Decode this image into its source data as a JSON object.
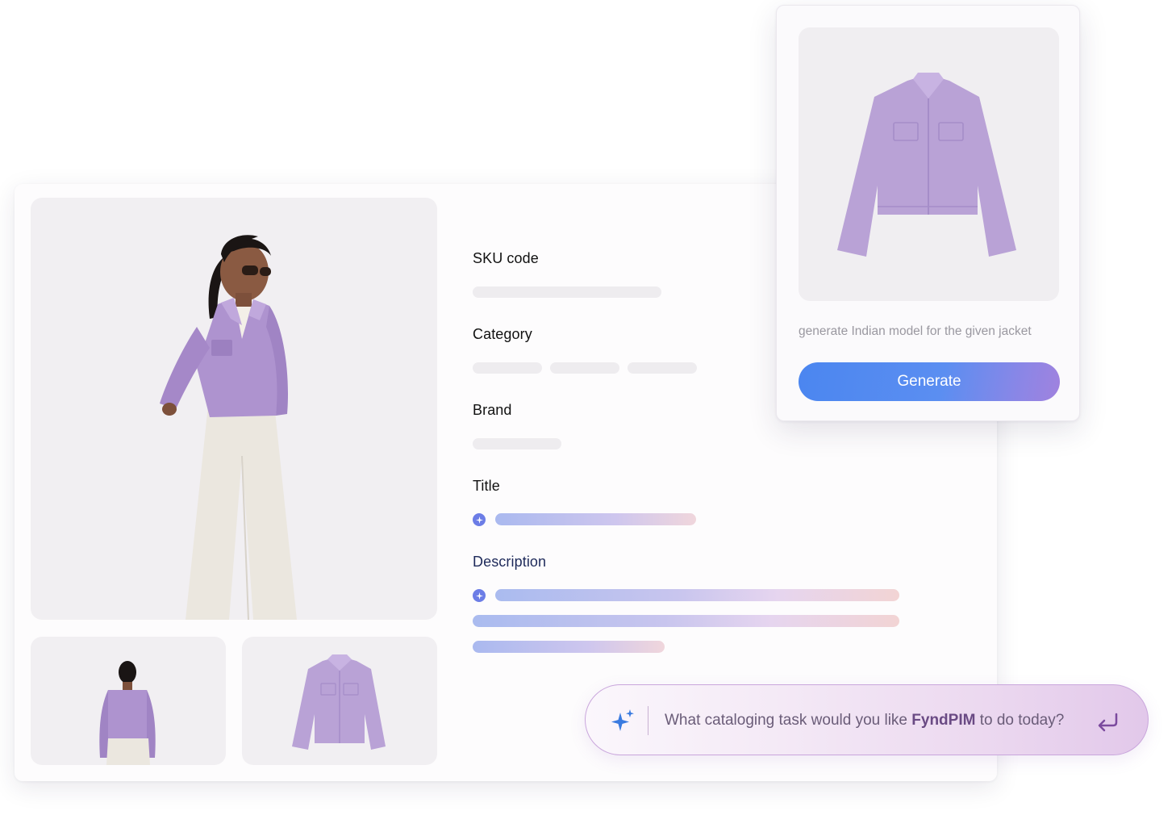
{
  "product_form": {
    "fields": [
      {
        "label": "SKU code"
      },
      {
        "label": "Category"
      },
      {
        "label": "Brand"
      },
      {
        "label": "Title"
      },
      {
        "label": "Description"
      }
    ]
  },
  "generate_panel": {
    "prompt": "generate Indian model for the given jacket",
    "button_label": "Generate"
  },
  "chat": {
    "text_before": "What cataloging task would you like ",
    "brand": "FyndPIM",
    "text_after": " to do today?"
  },
  "icons": [
    "sparkle-icon",
    "enter-icon",
    "ai-sparkle-icon"
  ],
  "colors": {
    "accent_blue": "#4b86f0",
    "accent_purple": "#a082de",
    "jacket_lavender": "#b9a2d6",
    "chat_border": "#c9a6dc"
  }
}
